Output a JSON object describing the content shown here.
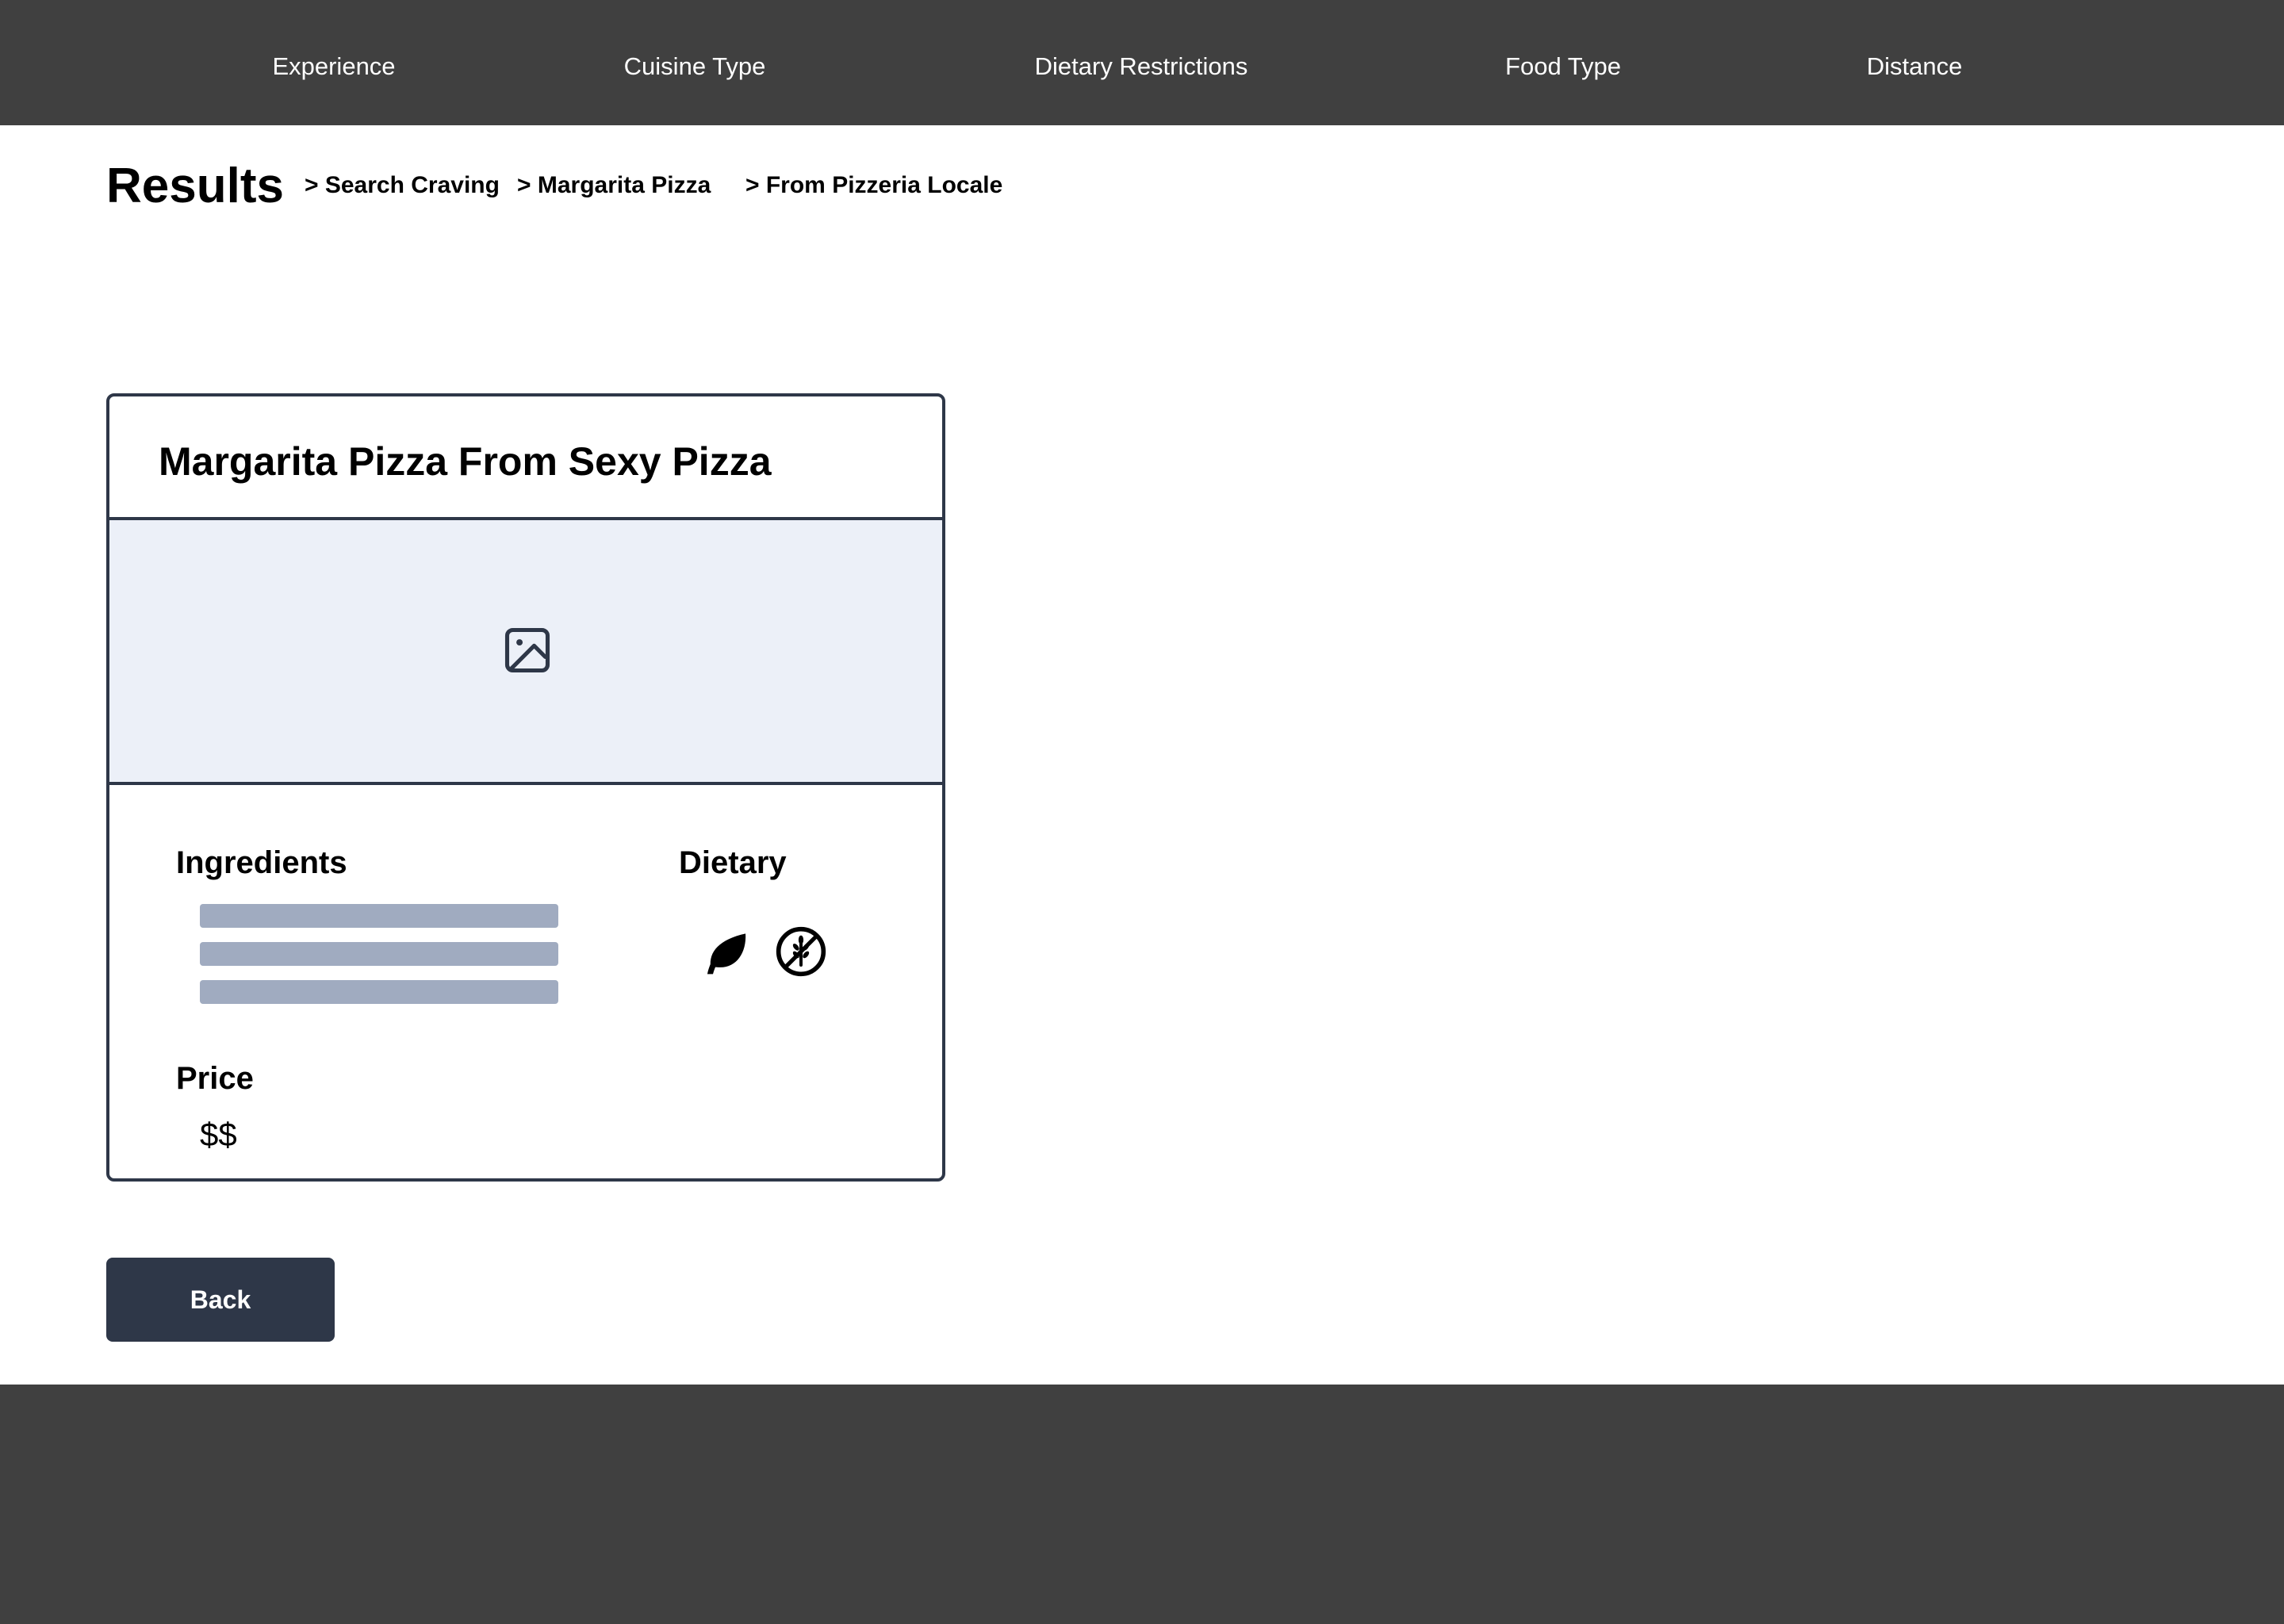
{
  "nav": {
    "items": [
      {
        "label": "Experience"
      },
      {
        "label": "Cuisine Type"
      },
      {
        "label": "Dietary Restrictions"
      },
      {
        "label": "Food Type"
      },
      {
        "label": "Distance"
      }
    ]
  },
  "page": {
    "title": "Results"
  },
  "breadcrumb": {
    "items": [
      {
        "label": "> Search Craving"
      },
      {
        "label": "> Margarita Pizza"
      },
      {
        "label": "> From Pizzeria Locale"
      }
    ]
  },
  "card": {
    "title": "Margarita Pizza From Sexy Pizza",
    "image_icon": "image-placeholder-icon",
    "ingredients_label": "Ingredients",
    "ingredient_placeholder_count": 3,
    "dietary_label": "Dietary",
    "dietary_icons": [
      "leaf-icon",
      "gluten-free-icon"
    ],
    "price_label": "Price",
    "price_value": "$$"
  },
  "actions": {
    "back_label": "Back"
  },
  "colors": {
    "nav_background": "#404040",
    "primary_dark": "#2e3748",
    "image_placeholder_bg": "#ecf0f8",
    "skeleton_bar": "#a0abc0"
  }
}
